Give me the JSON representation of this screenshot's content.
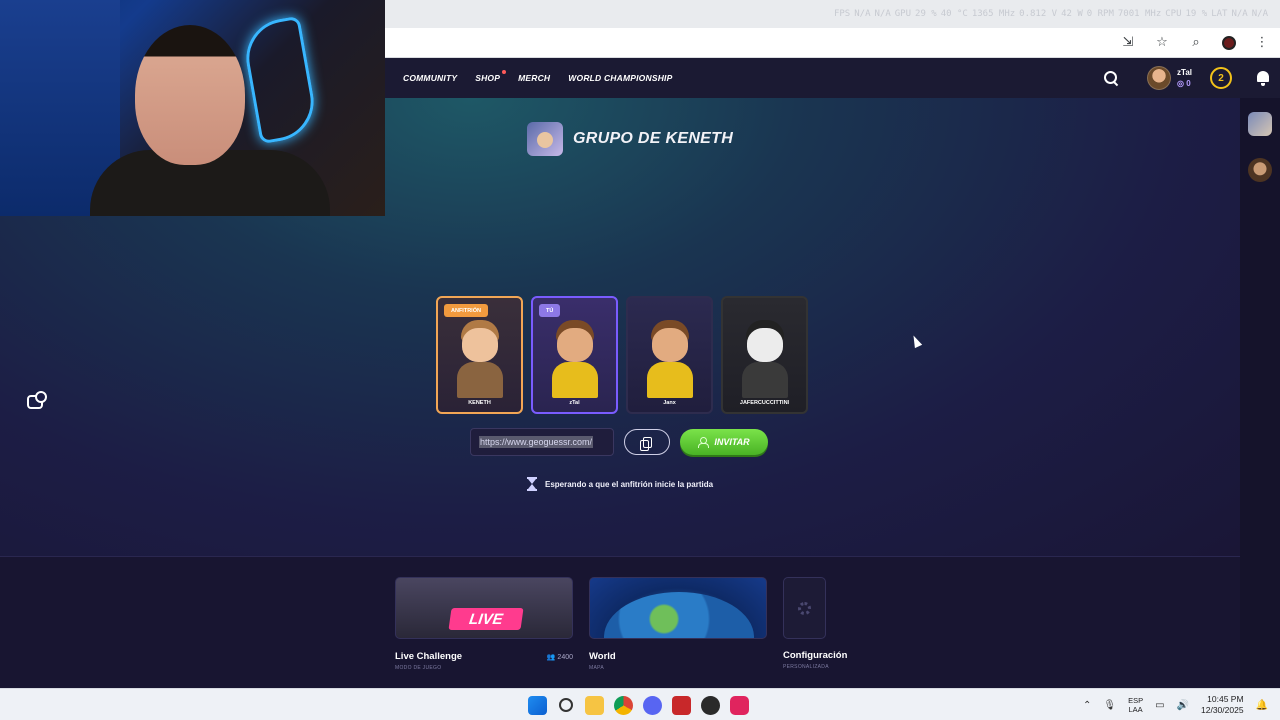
{
  "overlay": {
    "stats": [
      "FPS",
      "N/A",
      "N/A",
      "GPU",
      "29 %",
      "40 °C",
      "1365 MHz",
      "0.812 V",
      "42 W",
      "0 RPM",
      "7001 MHz",
      "CPU",
      "19 %",
      "LAT",
      "N/A",
      "N/A"
    ]
  },
  "nav": {
    "items": [
      {
        "label": "COMMUNITY"
      },
      {
        "label": "SHOP"
      },
      {
        "label": "MERCH"
      },
      {
        "label": "WORLD CHAMPIONSHIP"
      }
    ],
    "user": {
      "name": "zTal",
      "coins": "0"
    },
    "level": "2"
  },
  "party": {
    "title": "GRUPO DE KENETH",
    "players": [
      {
        "name": "KENETH",
        "tag": "ANFITRIÓN",
        "role": "host"
      },
      {
        "name": "zTal",
        "tag": "TÚ",
        "role": "me"
      },
      {
        "name": "Janx",
        "tag": "",
        "role": "member"
      },
      {
        "name": "JAFERCUCCITTINI",
        "tag": "",
        "role": "gray"
      }
    ],
    "invite_link": "https://www.geoguessr.com/",
    "invite_label": "INVITAR",
    "waiting_text": "Esperando a que el anfitrión inicie la partida"
  },
  "modes": [
    {
      "title": "Live Challenge",
      "subtitle": "MODO DE JUEGO",
      "count": "2400",
      "badge": "LIVE"
    },
    {
      "title": "World",
      "subtitle": "MAPA"
    },
    {
      "title": "Configuración",
      "subtitle": "PERSONALIZADA"
    }
  ],
  "taskbar": {
    "lang": "ESP",
    "layout": "LAA",
    "time": "10:45 PM",
    "date": "12/30/2025"
  }
}
